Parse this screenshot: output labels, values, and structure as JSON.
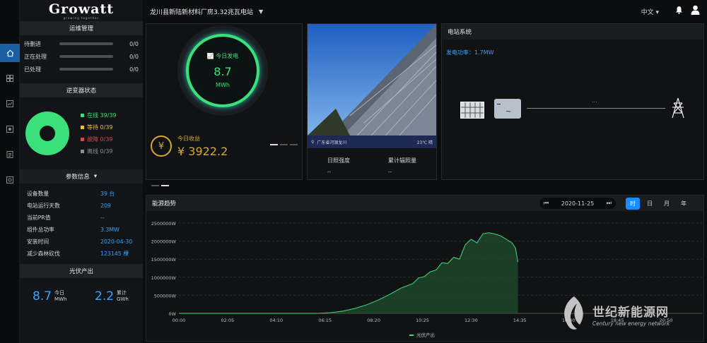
{
  "brand": {
    "name": "Growatt",
    "tagline": "growing together"
  },
  "header": {
    "plant_name": "龙川县新陆新材料厂房3.32兆瓦电站",
    "language": "中文"
  },
  "maintenance": {
    "title": "运维管理",
    "items": [
      {
        "label": "待删进",
        "value": "0/0"
      },
      {
        "label": "正在处理",
        "value": "0/0"
      },
      {
        "label": "已处理",
        "value": "0/0"
      }
    ]
  },
  "inverter_status": {
    "title": "逆变器状态",
    "items": [
      {
        "label": "在线 39/39",
        "color": "#3ce07a"
      },
      {
        "label": "等待 0/39",
        "color": "#e8c23a"
      },
      {
        "label": "故障 0/39",
        "color": "#e04848"
      },
      {
        "label": "离线 0/39",
        "color": "#8a8d92"
      }
    ]
  },
  "params": {
    "title": "参数信息",
    "rows": [
      {
        "label": "设备数量",
        "value": "39 台"
      },
      {
        "label": "电站运行天数",
        "value": "209"
      },
      {
        "label": "当前PR值",
        "value": "--"
      },
      {
        "label": "组件总功率",
        "value": "3.3MW"
      },
      {
        "label": "安装时间",
        "value": "2020-04-30"
      },
      {
        "label": "减少森林砍伐",
        "value": "123145 棵"
      }
    ]
  },
  "pv_output": {
    "title": "光伏产出",
    "today_value": "8.7",
    "today_label": "今日",
    "today_unit": "MWh",
    "total_value": "2.2",
    "total_label": "累计",
    "total_unit": "GWh"
  },
  "today_power": {
    "label": "今日发电",
    "value": "8.7",
    "unit": "MWh"
  },
  "today_income": {
    "label": "今日收益",
    "value": "¥ 3922.2"
  },
  "location": {
    "place": "广东省河源龙川",
    "weather": "23℃ 晴",
    "irradiance_label": "日照强度",
    "irradiance_value": "--",
    "cumulative_label": "累计辐照量",
    "cumulative_value": "--"
  },
  "station_system": {
    "title": "电站系统",
    "power_label": "发电功率：",
    "power_value": "1.7MW",
    "flow_text": "..."
  },
  "energy_trend": {
    "title": "能源趋势",
    "date": "2020-11-25",
    "tabs": [
      "时",
      "日",
      "月",
      "年"
    ],
    "active_tab": "时"
  },
  "chart_data": {
    "type": "area",
    "x": [
      "00:00",
      "02:05",
      "04:10",
      "06:15",
      "08:20",
      "10:25",
      "12:30",
      "14:35",
      "16:40",
      "18:45",
      "20:50"
    ],
    "y_ticks": [
      "2500000W",
      "2000000W",
      "1500000W",
      "1000000W",
      "500000W",
      "0W"
    ],
    "ylim": [
      0,
      2500000
    ],
    "series": [
      {
        "name": "光伏产出",
        "color": "#3ce07a",
        "points": [
          [
            0,
            0
          ],
          [
            6.0,
            0
          ],
          [
            6.5,
            20000
          ],
          [
            7.0,
            60000
          ],
          [
            7.5,
            130000
          ],
          [
            8.0,
            230000
          ],
          [
            8.5,
            360000
          ],
          [
            9.0,
            520000
          ],
          [
            9.5,
            700000
          ],
          [
            10.0,
            820000
          ],
          [
            10.25,
            980000
          ],
          [
            10.5,
            1020000
          ],
          [
            10.75,
            1150000
          ],
          [
            11.0,
            1200000
          ],
          [
            11.25,
            1400000
          ],
          [
            11.5,
            1380000
          ],
          [
            11.75,
            1550000
          ],
          [
            12.0,
            1500000
          ],
          [
            12.25,
            1900000
          ],
          [
            12.5,
            2050000
          ],
          [
            12.75,
            1950000
          ],
          [
            13.0,
            2200000
          ],
          [
            13.25,
            2230000
          ],
          [
            13.5,
            2200000
          ],
          [
            13.75,
            2150000
          ],
          [
            14.0,
            2050000
          ],
          [
            14.25,
            1950000
          ],
          [
            14.4,
            1800000
          ],
          [
            14.5,
            1420000
          ]
        ]
      }
    ]
  }
}
